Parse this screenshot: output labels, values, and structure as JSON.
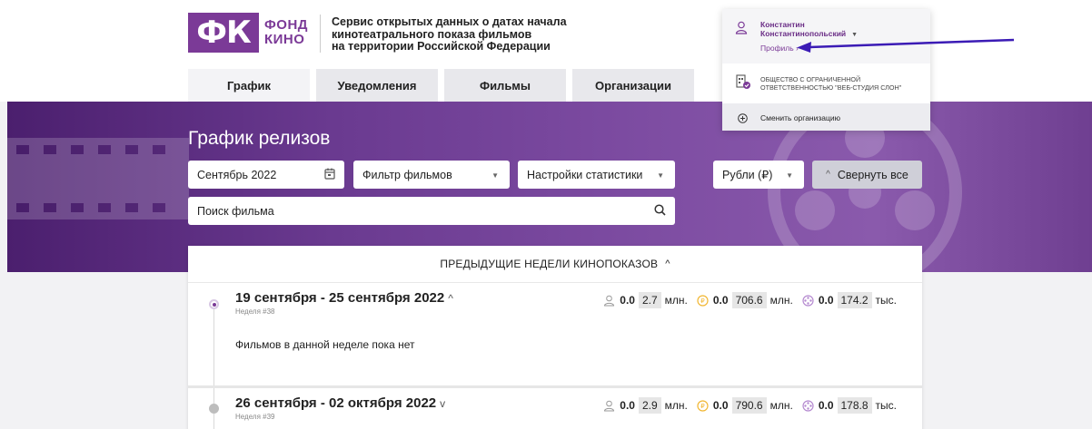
{
  "logo": {
    "mark": "ФК",
    "line1": "ФОНД",
    "line2": "КИНО"
  },
  "service_description": [
    "Сервис открытых данных о датах начала",
    "кинотеатрального показа фильмов",
    "на территории Российской Федерации"
  ],
  "nav": {
    "tabs": [
      {
        "label": "График",
        "active": true
      },
      {
        "label": "Уведомления",
        "active": false
      },
      {
        "label": "Фильмы",
        "active": false
      },
      {
        "label": "Организации",
        "active": false
      }
    ]
  },
  "hero": {
    "title": "График релизов",
    "month_picker": "Сентябрь 2022",
    "film_filter": "Фильтр фильмов",
    "stats_settings": "Настройки статистики",
    "currency": "Рубли (₽)",
    "collapse_all": "Свернуть все",
    "search_placeholder": "Поиск фильма"
  },
  "schedule": {
    "previous_weeks_label": "ПРЕДЫДУЩИЕ НЕДЕЛИ КИНОПОКАЗОВ",
    "weeks": [
      {
        "title": "19 сентября - 25 сентября 2022",
        "number": "Неделя #38",
        "viewers": "0.0",
        "viewers_box": "2.7",
        "viewers_unit": "млн.",
        "revenue": "0.0",
        "revenue_box": "706.6",
        "revenue_unit": "млн.",
        "sessions": "0.0",
        "sessions_box": "174.2",
        "sessions_unit": "тыс.",
        "empty_note": "Фильмов в данной неделе пока нет"
      },
      {
        "title": "26 сентября - 02 октября 2022",
        "number": "Неделя #39",
        "viewers": "0.0",
        "viewers_box": "2.9",
        "viewers_unit": "млн.",
        "revenue": "0.0",
        "revenue_box": "790.6",
        "revenue_unit": "млн.",
        "sessions": "0.0",
        "sessions_box": "178.8",
        "sessions_unit": "тыс."
      }
    ]
  },
  "profile_menu": {
    "user_first_name": "Константин",
    "user_last_name": "Константинопольский",
    "profile_link": "Профиль ›",
    "organization_line1": "ОБЩЕСТВО С ОГРАНИЧЕННОЙ",
    "organization_line2": "ОТВЕТСТВЕННОСТЬЮ \"ВЕБ-СТУДИЯ СЛОН\"",
    "switch_org": "Сменить организацию"
  },
  "colors": {
    "brand": "#7b3a97",
    "annotation_arrow": "#3b1bb5",
    "coin": "#f1b733",
    "film": "#b58ad0"
  }
}
